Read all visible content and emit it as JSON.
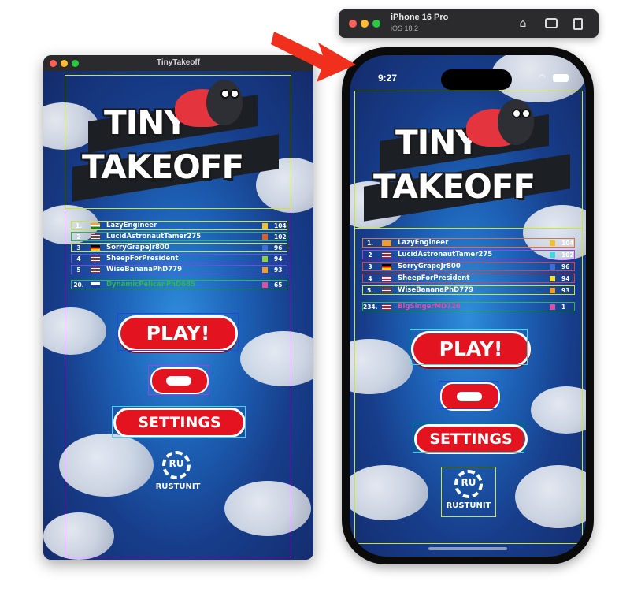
{
  "mac_window": {
    "title": "TinyTakeoff"
  },
  "simulator": {
    "device": "iPhone 16 Pro",
    "os": "iOS 18.2",
    "time": "9:27"
  },
  "logo": {
    "line1": "TINY",
    "line2": "TAKEOFF"
  },
  "mac_leaderboard": [
    {
      "rank": "1.",
      "name": "LazyEngineer",
      "score": "104"
    },
    {
      "rank": "2",
      "name": "LucidAstronautTamer275",
      "score": "102"
    },
    {
      "rank": "3",
      "name": "SorryGrapeJr800",
      "score": "96"
    },
    {
      "rank": "4",
      "name": "SheepForPresident",
      "score": "94"
    },
    {
      "rank": "5",
      "name": "WiseBananaPhD779",
      "score": "93"
    },
    {
      "rank": "20.",
      "name": "DynamicPelicanPhD685",
      "score": "65"
    }
  ],
  "ios_leaderboard": [
    {
      "rank": "1.",
      "name": "LazyEngineer",
      "score": "104"
    },
    {
      "rank": "2",
      "name": "LucidAstronautTamer275",
      "score": "102"
    },
    {
      "rank": "3",
      "name": "SorryGrapeJr800",
      "score": "96"
    },
    {
      "rank": "4",
      "name": "SheepForPresident",
      "score": "94"
    },
    {
      "rank": "5.",
      "name": "WiseBananaPhD779",
      "score": "93"
    },
    {
      "rank": "234.",
      "name": "BigSingerMD726",
      "score": "1"
    }
  ],
  "buttons": {
    "play": "PLAY!",
    "settings": "SETTINGS"
  },
  "brand": {
    "mark": "RU",
    "name": "RUSTUNIT"
  },
  "colors": {
    "button_red": "#e3131f",
    "arrow_red": "#f0301c",
    "sky_blue": "#1d62b7"
  }
}
